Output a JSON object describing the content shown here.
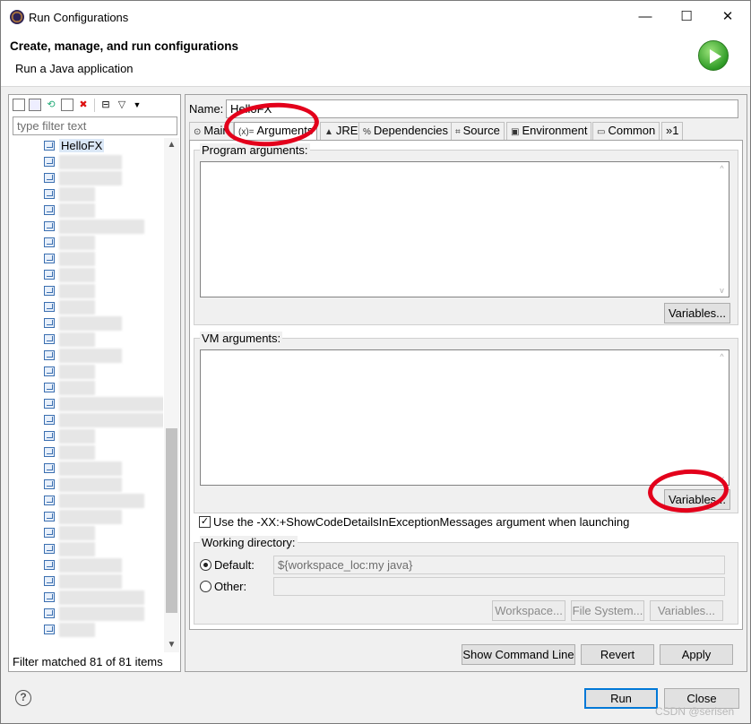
{
  "window": {
    "title": "Run Configurations",
    "minimize": "—",
    "maximize": "☐",
    "close": "✕"
  },
  "header": {
    "title": "Create, manage, and run configurations",
    "subtitle": "Run a Java application"
  },
  "left": {
    "filter_placeholder": "type filter text",
    "tree_root": "HelloFX",
    "item_count_rows": 31,
    "status": "Filter matched 81 of 81 items"
  },
  "right": {
    "name_label": "Name:",
    "name_value": "HelloFX",
    "tabs": [
      {
        "label": "Main",
        "icon": "main-icon",
        "glyph": "⊙"
      },
      {
        "label": "Arguments",
        "icon": "arguments-icon",
        "glyph": "(x)="
      },
      {
        "label": "JRE",
        "icon": "jre-icon",
        "glyph": "▲"
      },
      {
        "label": "Dependencies",
        "icon": "dependencies-icon",
        "glyph": "%"
      },
      {
        "label": "Source",
        "icon": "source-icon",
        "glyph": "⌗"
      },
      {
        "label": "Environment",
        "icon": "environment-icon",
        "glyph": "▣"
      },
      {
        "label": "Common",
        "icon": "common-icon",
        "glyph": "▭"
      },
      {
        "label": "»1",
        "icon": "overflow-icon",
        "glyph": ""
      }
    ],
    "active_tab": "Arguments",
    "program_args_label": "Program arguments:",
    "program_args_value": "",
    "vm_args_label": "VM arguments:",
    "vm_args_value": "",
    "variables_label": "Variables...",
    "show_code_details_label": "Use the -XX:+ShowCodeDetailsInExceptionMessages argument when launching",
    "show_code_details_checked": true,
    "working_dir_label": "Working directory:",
    "default_label": "Default:",
    "default_value": "${workspace_loc:my java}",
    "other_label": "Other:",
    "other_value": "",
    "workspace_btn": "Workspace...",
    "filesystem_btn": "File System...",
    "variables_btn2": "Variables..."
  },
  "bottom": {
    "show_command_line": "Show Command Line",
    "revert": "Revert",
    "apply": "Apply",
    "run": "Run",
    "close": "Close"
  },
  "watermark": "CSDN @serisen",
  "colors": {
    "annotation": "#e3001b",
    "accent": "#0078d7"
  }
}
